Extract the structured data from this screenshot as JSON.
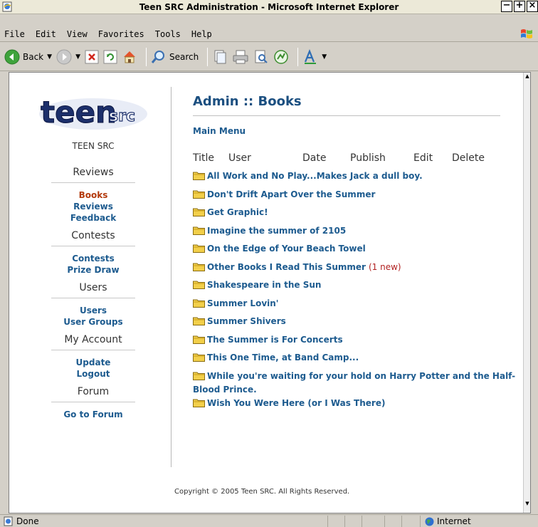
{
  "window": {
    "title": "Teen SRC Administration - Microsoft Internet Explorer",
    "buttons": {
      "minimize": "−",
      "maximize": "+",
      "close": "×"
    }
  },
  "menubar": {
    "items": [
      "File",
      "Edit",
      "View",
      "Favorites",
      "Tools",
      "Help"
    ]
  },
  "toolbar": {
    "back_label": "Back",
    "search_label": "Search"
  },
  "sidebar": {
    "logo_text": "teensrc",
    "site_name": "TEEN SRC",
    "sections": [
      {
        "heading": "Reviews",
        "links": [
          "Books",
          "Reviews",
          "Feedback"
        ]
      },
      {
        "heading": "Contests",
        "links": [
          "Contests",
          "Prize Draw"
        ]
      },
      {
        "heading": "Users",
        "links": [
          "Users",
          "User Groups"
        ]
      },
      {
        "heading": "My Account",
        "links": [
          "Update",
          "Logout"
        ]
      },
      {
        "heading": "Forum",
        "links": [
          "Go to Forum"
        ]
      }
    ],
    "active_link": "Books"
  },
  "main": {
    "title": "Admin :: Books",
    "main_menu_link": "Main Menu",
    "columns": [
      "Title",
      "User",
      "Date",
      "Publish",
      "Edit",
      "Delete"
    ],
    "books": [
      {
        "title": "All Work and No Play...Makes Jack a dull boy.",
        "badge": ""
      },
      {
        "title": "Don't Drift Apart Over the Summer",
        "badge": ""
      },
      {
        "title": "Get Graphic!",
        "badge": ""
      },
      {
        "title": "Imagine the summer of 2105",
        "badge": ""
      },
      {
        "title": "On the Edge of Your Beach Towel",
        "badge": ""
      },
      {
        "title": "Other Books I Read This Summer",
        "badge": "(1 new)"
      },
      {
        "title": "Shakespeare in the Sun",
        "badge": ""
      },
      {
        "title": "Summer Lovin'",
        "badge": ""
      },
      {
        "title": "Summer Shivers",
        "badge": ""
      },
      {
        "title": "The Summer is For Concerts",
        "badge": ""
      },
      {
        "title": "This One Time, at Band Camp...",
        "badge": ""
      },
      {
        "title": "While you're waiting for your hold on Harry Potter and the Half-Blood Prince.",
        "badge": ""
      },
      {
        "title": "Wish You Were Here (or I Was There)",
        "badge": ""
      }
    ],
    "copyright": "Copyright © 2005 Teen SRC. All Rights Reserved."
  },
  "statusbar": {
    "status": "Done",
    "zone": "Internet"
  },
  "colors": {
    "link": "#1d5b8f",
    "active_link": "#b33a0c",
    "title": "#1b4f80",
    "badge": "#b22222",
    "chrome": "#d4d0c8"
  }
}
